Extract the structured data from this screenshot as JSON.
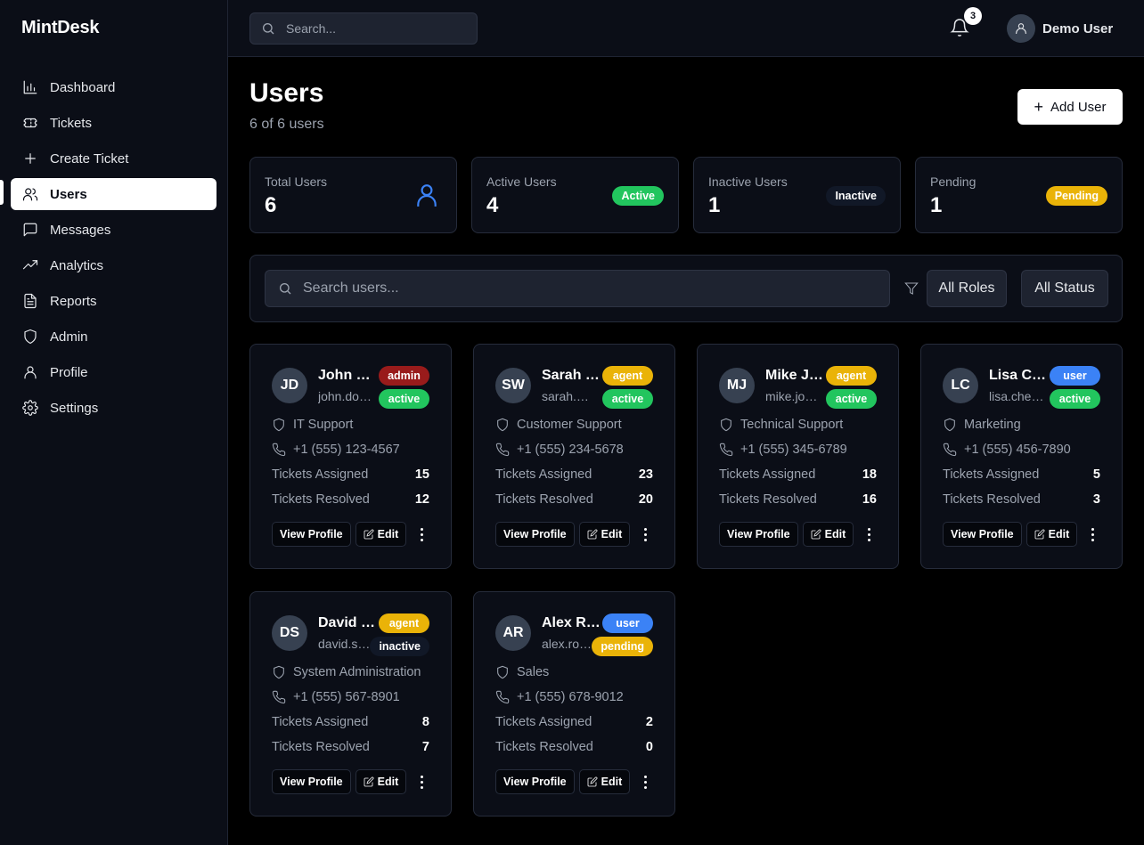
{
  "app": {
    "name": "MintDesk"
  },
  "colors": {
    "admin": "#991b1b",
    "agent": "#eab308",
    "user": "#3b82f6",
    "active": "#22c55e",
    "inactive": "#111827",
    "pending": "#eab308",
    "accent": "#3b82f6"
  },
  "sidebar": {
    "items": [
      {
        "label": "Dashboard",
        "icon": "bar-chart-icon"
      },
      {
        "label": "Tickets",
        "icon": "ticket-icon"
      },
      {
        "label": "Create Ticket",
        "icon": "plus-icon"
      },
      {
        "label": "Users",
        "icon": "users-icon"
      },
      {
        "label": "Messages",
        "icon": "message-icon"
      },
      {
        "label": "Analytics",
        "icon": "trending-up-icon"
      },
      {
        "label": "Reports",
        "icon": "file-text-icon"
      },
      {
        "label": "Admin",
        "icon": "shield-icon"
      },
      {
        "label": "Profile",
        "icon": "user-icon"
      },
      {
        "label": "Settings",
        "icon": "gear-icon"
      }
    ],
    "active": "Users"
  },
  "topbar": {
    "search_placeholder": "Search...",
    "notification_count": "3",
    "user_name": "Demo User"
  },
  "page": {
    "title": "Users",
    "subtitle": "6 of 6 users",
    "add_label": "Add User"
  },
  "stats": [
    {
      "label": "Total Users",
      "value": "6"
    },
    {
      "label": "Active Users",
      "value": "4",
      "badge": "Active"
    },
    {
      "label": "Inactive Users",
      "value": "1",
      "badge": "Inactive"
    },
    {
      "label": "Pending",
      "value": "1",
      "badge": "Pending"
    }
  ],
  "filters": {
    "search_placeholder": "Search users...",
    "roles_label": "All Roles",
    "status_label": "All Status"
  },
  "labels": {
    "assigned": "Tickets Assigned",
    "resolved": "Tickets Resolved",
    "view_profile": "View Profile",
    "edit": "Edit"
  },
  "users": [
    {
      "initials": "JD",
      "name": "John Doe",
      "email": "john.doe@company.com",
      "role": "admin",
      "status": "active",
      "department": "IT Support",
      "phone": "+1 (555) 123-4567",
      "assigned": "15",
      "resolved": "12"
    },
    {
      "initials": "SW",
      "name": "Sarah Wilson",
      "email": "sarah.wilson@company.com",
      "role": "agent",
      "status": "active",
      "department": "Customer Support",
      "phone": "+1 (555) 234-5678",
      "assigned": "23",
      "resolved": "20"
    },
    {
      "initials": "MJ",
      "name": "Mike Johnson",
      "email": "mike.johnson@company.com",
      "role": "agent",
      "status": "active",
      "department": "Technical Support",
      "phone": "+1 (555) 345-6789",
      "assigned": "18",
      "resolved": "16"
    },
    {
      "initials": "LC",
      "name": "Lisa Chen",
      "email": "lisa.chen@company.com",
      "role": "user",
      "status": "active",
      "department": "Marketing",
      "phone": "+1 (555) 456-7890",
      "assigned": "5",
      "resolved": "3"
    },
    {
      "initials": "DS",
      "name": "David Smith",
      "email": "david.smith@company.com",
      "role": "agent",
      "status": "inactive",
      "department": "System Administration",
      "phone": "+1 (555) 567-8901",
      "assigned": "8",
      "resolved": "7"
    },
    {
      "initials": "AR",
      "name": "Alex Rodriguez",
      "email": "alex.rodriguez@company.com",
      "role": "user",
      "status": "pending",
      "department": "Sales",
      "phone": "+1 (555) 678-9012",
      "assigned": "2",
      "resolved": "0"
    }
  ]
}
